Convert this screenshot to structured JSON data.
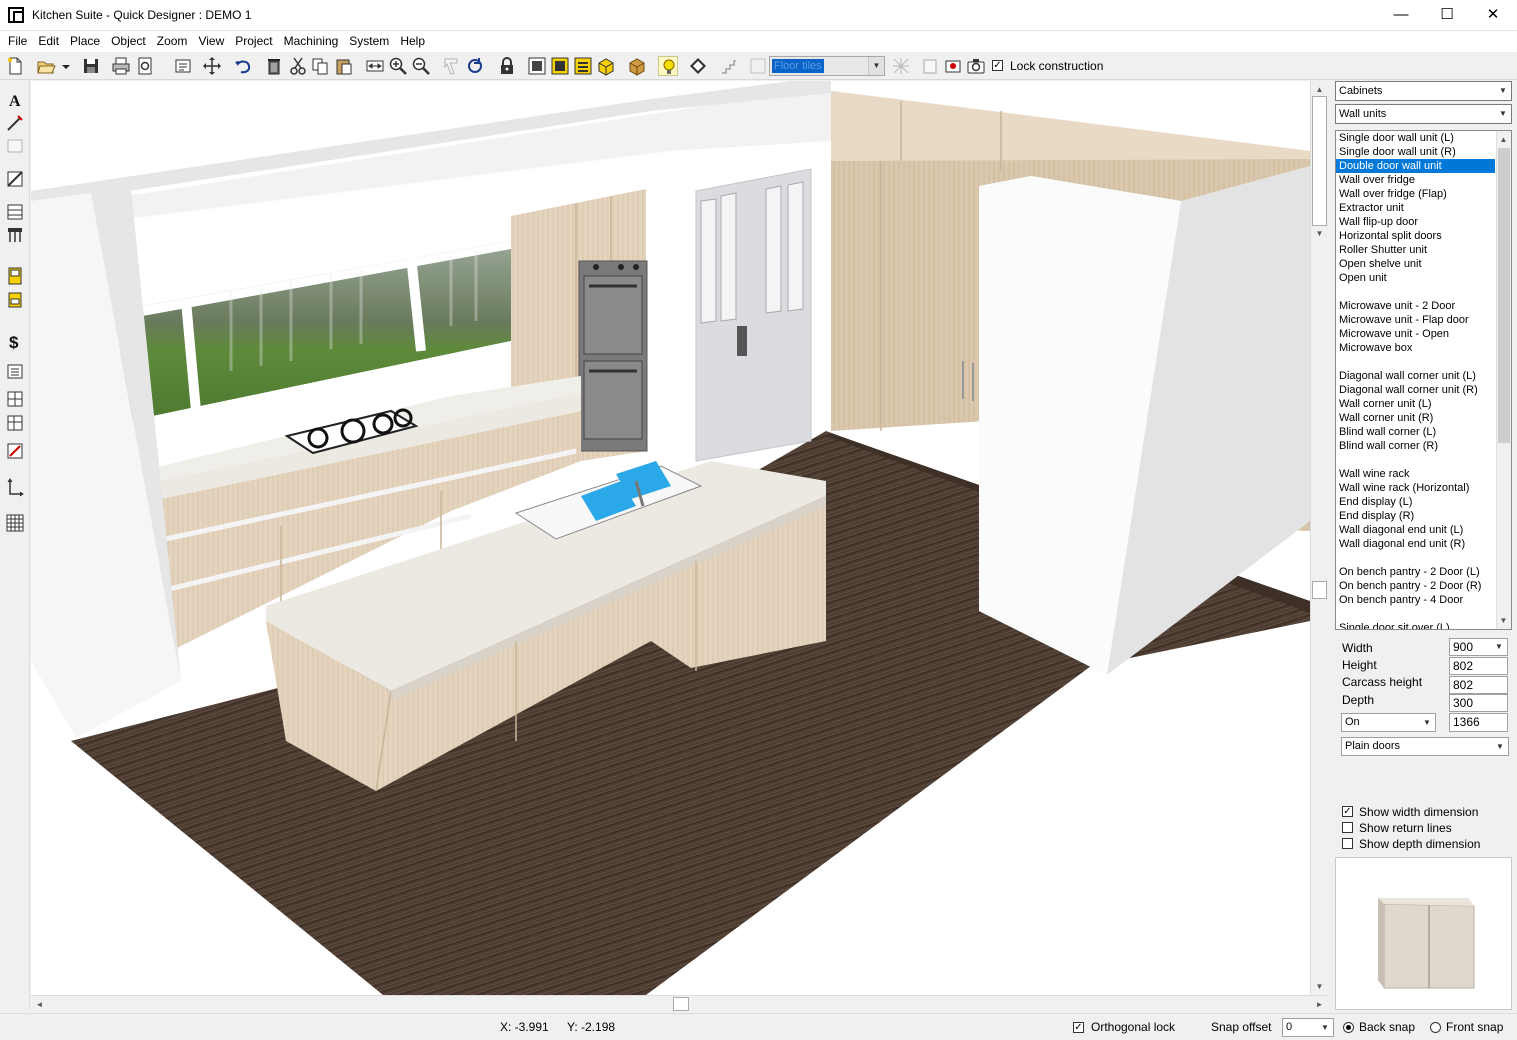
{
  "window": {
    "title": "Kitchen Suite - Quick Designer : DEMO 1",
    "minimize": "—",
    "maximize": "☐",
    "close": "✕"
  },
  "menu": [
    "File",
    "Edit",
    "Place",
    "Object",
    "Zoom",
    "View",
    "Project",
    "Machining",
    "System",
    "Help"
  ],
  "toolbar": {
    "floor_combo_value": "Floor tiles",
    "lock_construction_label": "Lock construction",
    "lock_construction_checked": true
  },
  "right_panel": {
    "category": "Cabinets",
    "subcategory": "Wall units",
    "items": [
      "Single door wall unit (L)",
      "Single door wall unit (R)",
      "Double door wall unit",
      "Wall over fridge",
      "Wall over fridge (Flap)",
      "Extractor unit",
      "Wall flip-up door",
      "Horizontal split doors",
      "Roller Shutter unit",
      "Open shelve unit",
      "Open unit",
      "",
      "Microwave unit - 2 Door",
      "Microwave unit - Flap door",
      "Microwave unit - Open",
      "Microwave box",
      "",
      "Diagonal wall corner unit (L)",
      "Diagonal wall corner unit (R)",
      "Wall corner unit (L)",
      "Wall corner unit (R)",
      "Blind wall corner (L)",
      "Blind wall corner (R)",
      "",
      "Wall wine rack",
      "Wall wine rack (Horizontal)",
      "End display (L)",
      "End display (R)",
      "Wall diagonal end unit (L)",
      "Wall diagonal end unit (R)",
      "",
      "On bench pantry - 2 Door (L)",
      "On bench pantry - 2 Door (R)",
      "On bench pantry - 4 Door",
      "",
      "Single door sit over (L)"
    ],
    "selected_index": 2,
    "props": {
      "width_label": "Width",
      "width_value": "900",
      "height_label": "Height",
      "height_value": "802",
      "carcass_label": "Carcass height",
      "carcass_value": "802",
      "depth_label": "Depth",
      "depth_value": "300",
      "on_value": "On",
      "on_number": "1366",
      "door_style": "Plain doors"
    },
    "options": {
      "show_width": "Show width dimension",
      "show_width_checked": true,
      "show_return": "Show return lines",
      "show_return_checked": false,
      "show_depth": "Show depth dimension",
      "show_depth_checked": false
    }
  },
  "status": {
    "x_coord": "X: -3.991",
    "y_coord": "Y: -2.198",
    "ortho_label": "Orthogonal lock",
    "ortho_checked": true,
    "snap_offset_label": "Snap offset",
    "snap_offset_value": "0",
    "back_snap": "Back snap",
    "front_snap": "Front snap",
    "snap_selected": "back"
  },
  "colors": {
    "selection": "#0078d7",
    "floor": "#4a3a30",
    "cabinet_wood": "#e4d3bd",
    "benchtop": "#ece9e2",
    "sink_water": "#2aa8e8"
  }
}
